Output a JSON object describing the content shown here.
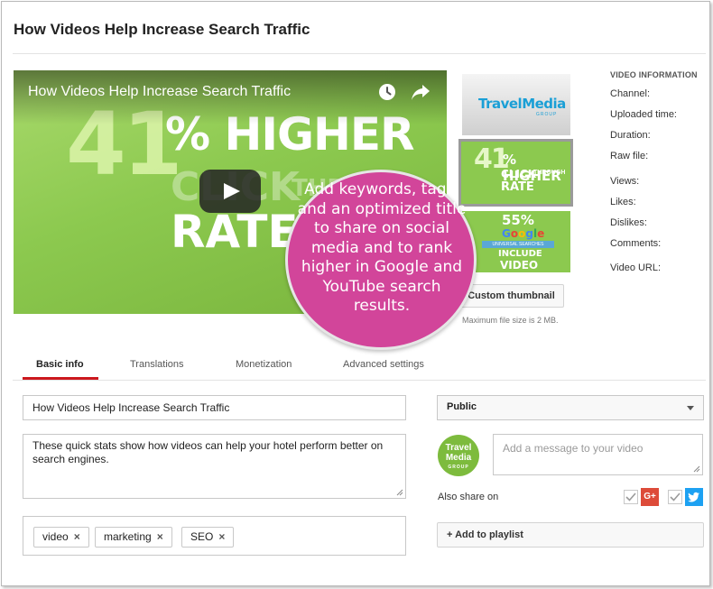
{
  "page": {
    "title": "How Videos Help Increase Search Traffic"
  },
  "player": {
    "title": "How Videos Help Increase Search Traffic",
    "frame_text": {
      "big_number": "41",
      "line1": "% HIGHER",
      "line2": "CLICK",
      "line2_small": "THROUGH",
      "line3": "RATE"
    },
    "icons": [
      "clock-icon",
      "share-icon",
      "play-icon"
    ]
  },
  "thumbnails": {
    "thumb1": {
      "brand": "TravelMedia",
      "group": "GROUP"
    },
    "thumb2": {
      "big": "41",
      "higher": "% HIGHER",
      "click": "CLICK",
      "through": "THROUGH",
      "rate": "RATE"
    },
    "thumb3": {
      "stat": "55%",
      "google": [
        "G",
        "o",
        "o",
        "g",
        "l",
        "e"
      ],
      "band": "UNIVERSAL SEARCHES",
      "include": "INCLUDE",
      "video": "VIDEO"
    },
    "custom_button": "Custom thumbnail",
    "max_size": "Maximum file size is 2 MB."
  },
  "video_info": {
    "heading": "VIDEO INFORMATION",
    "labels": [
      "Channel:",
      "Uploaded time:",
      "Duration:",
      "Raw file:",
      "Views:",
      "Likes:",
      "Dislikes:",
      "Comments:",
      "Video URL:"
    ]
  },
  "callout": {
    "text": "Add keywords, tags, and an optimized title to share on social media and to rank higher in Google and YouTube search results.",
    "color": "#d2459a"
  },
  "tabs": [
    {
      "label": "Basic info",
      "active": true
    },
    {
      "label": "Translations",
      "active": false
    },
    {
      "label": "Monetization",
      "active": false
    },
    {
      "label": "Advanced settings",
      "active": false
    }
  ],
  "form": {
    "title_value": "How Videos Help Increase Search Traffic",
    "description_value": "These quick stats show how videos can help your hotel perform better on search engines.",
    "tags": [
      "video",
      "marketing",
      "SEO"
    ],
    "tag_remove": "×",
    "privacy": "Public",
    "avatar": {
      "line1": "Travel",
      "line2": "Media",
      "line3": "GROUP"
    },
    "message_placeholder": "Add a message to your video",
    "also_share": "Also share on",
    "gplus_label": "G+",
    "share_targets": [
      "google-plus",
      "twitter"
    ],
    "playlist_button": "+ Add to playlist"
  },
  "colors": {
    "accent_red": "#cc181e",
    "video_green": "#8cc94f",
    "twitter_blue": "#1da1f2",
    "gplus_red": "#dd4b39"
  }
}
